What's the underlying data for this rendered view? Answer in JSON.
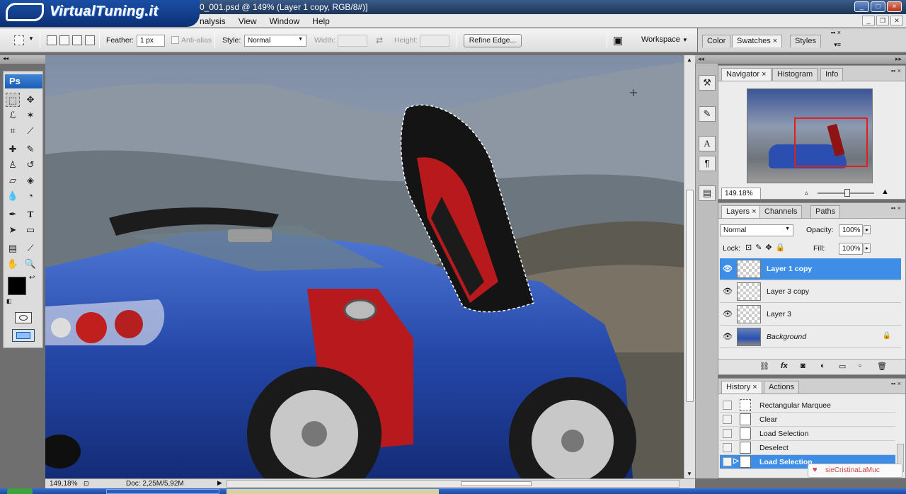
{
  "window": {
    "title": "0_001.psd @ 149% (Layer 1 copy, RGB/8#)]",
    "brand": "VirtualTuning.it",
    "controls": [
      "_",
      "□",
      "×"
    ]
  },
  "menu": [
    "nalysis",
    "View",
    "Window",
    "Help"
  ],
  "options": {
    "feather_label": "Feather:",
    "feather_value": "1 px",
    "antialias_label": "Anti-alias",
    "style_label": "Style:",
    "style_value": "Normal",
    "width_label": "Width:",
    "height_label": "Height:",
    "refine_edge": "Refine Edge...",
    "workspace": "Workspace"
  },
  "top_panel_tabs": [
    "Color",
    "Swatches",
    "Styles"
  ],
  "tools": {
    "header": "Ps"
  },
  "navigator": {
    "tabs": [
      "Navigator",
      "Histogram",
      "Info"
    ],
    "zoom": "149.18%"
  },
  "layers": {
    "tabs": [
      "Layers",
      "Channels",
      "Paths"
    ],
    "blend_mode": "Normal",
    "opacity_label": "Opacity:",
    "opacity_value": "100%",
    "lock_label": "Lock:",
    "fill_label": "Fill:",
    "fill_value": "100%",
    "items": [
      {
        "name": "Layer 1 copy",
        "selected": true
      },
      {
        "name": "Layer 3 copy",
        "selected": false
      },
      {
        "name": "Layer 3",
        "selected": false
      },
      {
        "name": "Background",
        "selected": false
      }
    ],
    "footer_icons": [
      "link-icon",
      "fx-icon",
      "mask-icon",
      "adjustment-icon",
      "group-icon",
      "new-layer-icon",
      "trash-icon"
    ]
  },
  "history": {
    "tabs": [
      "History",
      "Actions"
    ],
    "items": [
      {
        "name": "Rectangular Marquee",
        "selected": false
      },
      {
        "name": "Clear",
        "selected": false
      },
      {
        "name": "Load Selection",
        "selected": false
      },
      {
        "name": "Deselect",
        "selected": false
      },
      {
        "name": "Load Selection",
        "selected": true
      }
    ]
  },
  "status": {
    "zoom": "149,18%",
    "doc": "Doc: 2,25M/5,92M"
  },
  "watermark": "sieCristinaLaMuc",
  "colors": {
    "selection": "#3e8ee8",
    "car_blue": "#2a4fb0",
    "door_red": "#b8191d"
  }
}
